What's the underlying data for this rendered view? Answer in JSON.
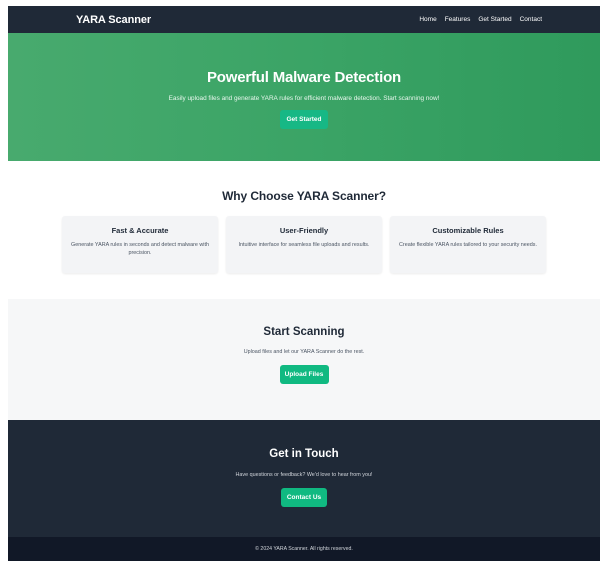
{
  "nav": {
    "brand": "YARA Scanner",
    "links": [
      "Home",
      "Features",
      "Get Started",
      "Contact"
    ]
  },
  "hero": {
    "title": "Powerful Malware Detection",
    "subtitle": "Easily upload files and generate YARA rules for efficient malware detection. Start scanning now!",
    "button": "Get Started"
  },
  "features": {
    "title": "Why Choose YARA Scanner?",
    "cards": [
      {
        "title": "Fast & Accurate",
        "text": "Generate YARA rules in seconds and detect malware with precision."
      },
      {
        "title": "User-Friendly",
        "text": "Intuitive interface for seamless file uploads and results."
      },
      {
        "title": "Customizable Rules",
        "text": "Create flexible YARA rules tailored to your security needs."
      }
    ]
  },
  "scan": {
    "title": "Start Scanning",
    "text": "Upload files and let our YARA Scanner do the rest.",
    "button": "Upload Files"
  },
  "contact": {
    "title": "Get in Touch",
    "text": "Have questions or feedback? We'd love to hear from you!",
    "button": "Contact Us"
  },
  "footer": {
    "text": "© 2024 YARA Scanner. All rights reserved."
  },
  "colors": {
    "nav_bg": "#1f2937",
    "hero_green": "#3ba466",
    "button_green": "#10b981",
    "footer_bg": "#111827"
  }
}
